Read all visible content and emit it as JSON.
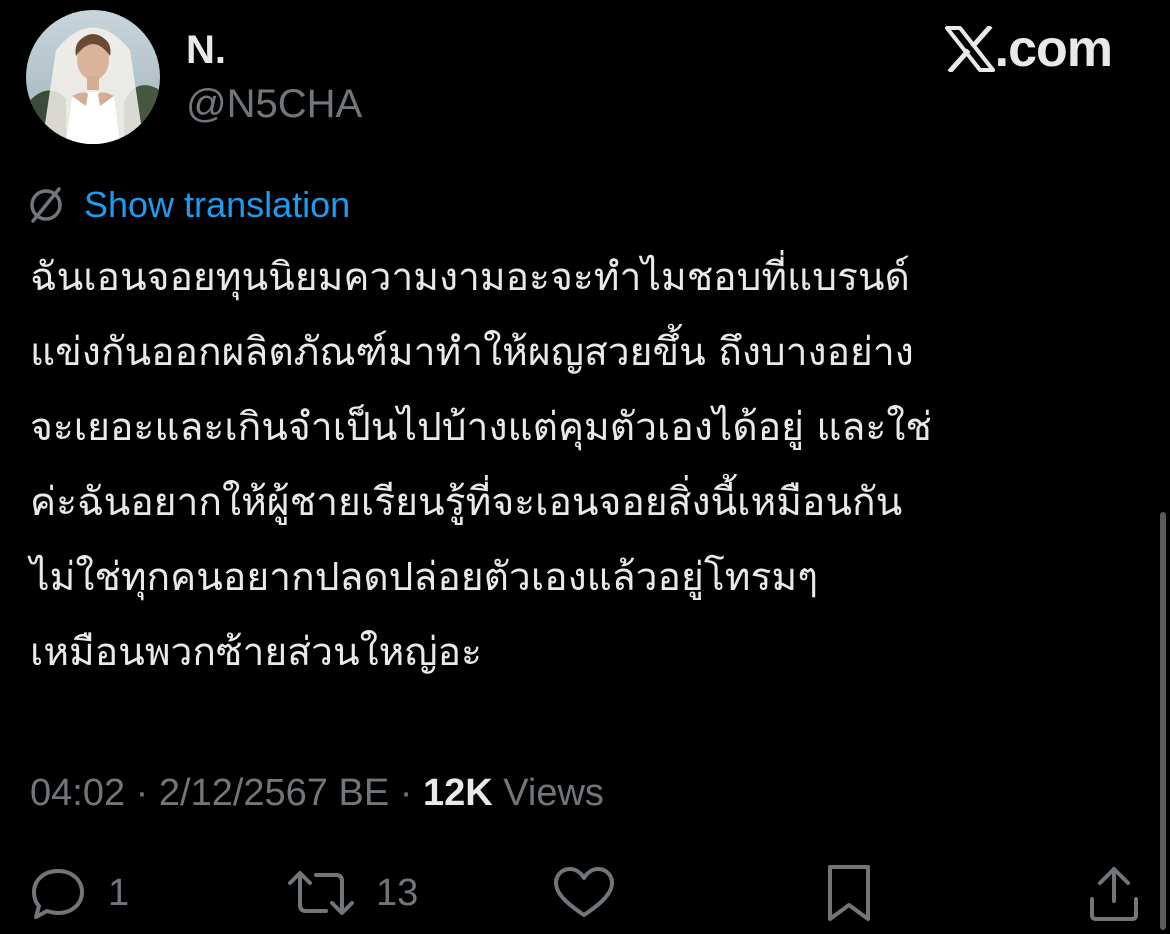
{
  "author": {
    "display_name": "N.",
    "handle": "@N5CHA",
    "avatar": "avatar-photo"
  },
  "brand": {
    "logo_icon": "x-logo-icon",
    "text": ".com"
  },
  "translation": {
    "icon": "globe-icon",
    "label": "Show translation",
    "color": "#1d9bf0"
  },
  "tweet": {
    "lines": [
      "ฉันเอนจอยทุนนิยมความงามอะจะทำไมชอบที่แบรนด์",
      "แข่งกันออกผลิตภัณฑ์มาทำให้ผญสวยขึ้น ถึงบางอย่าง",
      "จะเยอะและเกินจำเป็นไปบ้างแต่คุมตัวเองได้อยู่ และใช่",
      "ค่ะฉันอยากให้ผู้ชายเรียนรู้ที่จะเอนจอยสิ่งนี้เหมือนกัน",
      "ไม่ใช่ทุกคนอยากปลดปล่อยตัวเองแล้วอยู่โทรมๆ",
      "เหมือนพวกซ้ายส่วนใหญ่อะ"
    ]
  },
  "meta": {
    "time": "04:02",
    "separator": " · ",
    "date": "2/12/2567 BE",
    "views_count": "12K",
    "views_label": " Views"
  },
  "actions": {
    "reply": {
      "icon": "reply-icon",
      "count": "1"
    },
    "retweet": {
      "icon": "retweet-icon",
      "count": "13"
    },
    "like": {
      "icon": "heart-icon"
    },
    "bookmark": {
      "icon": "bookmark-icon"
    },
    "share": {
      "icon": "share-icon"
    }
  },
  "colors": {
    "background": "#000000",
    "text_primary": "#e7e9ea",
    "text_secondary": "#71767b",
    "link": "#1d9bf0"
  }
}
